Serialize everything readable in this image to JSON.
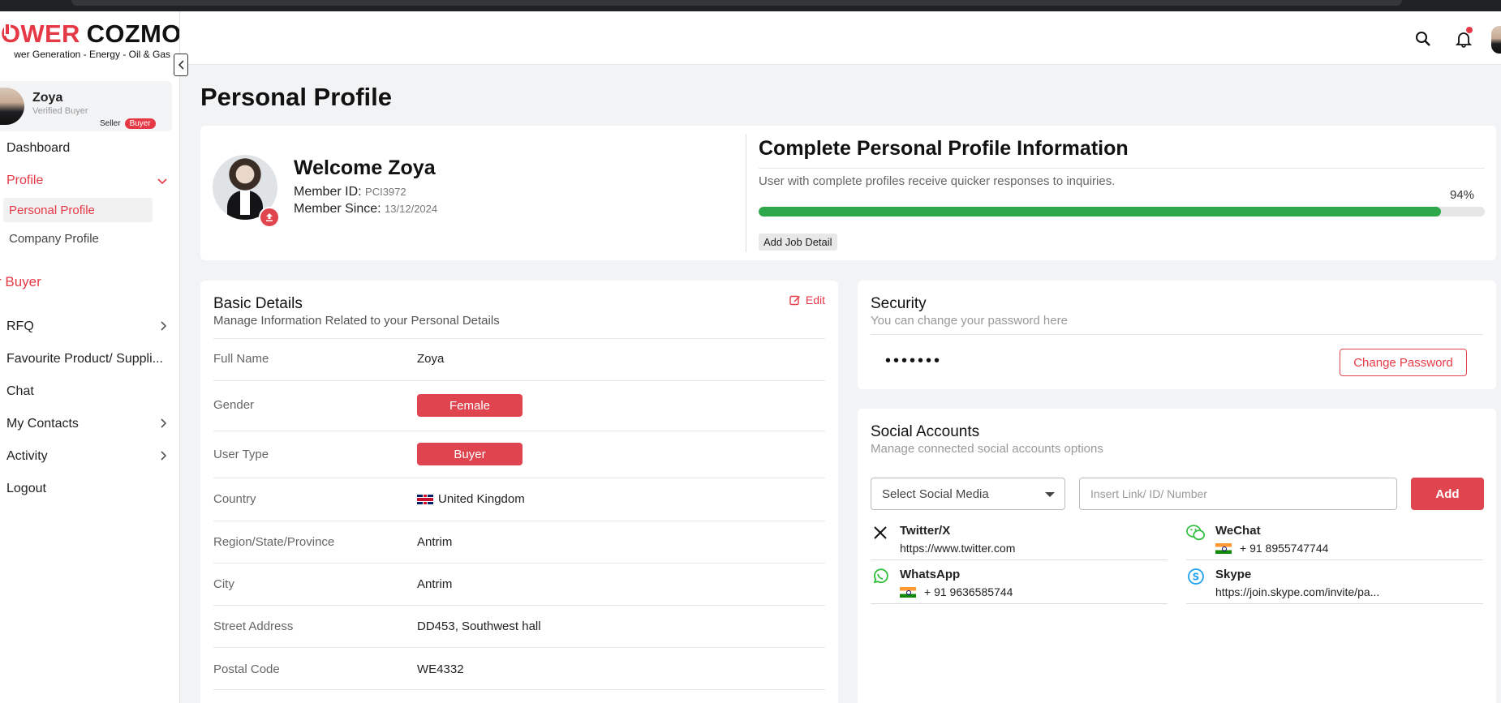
{
  "brand": {
    "logo_left": "OWER",
    "logo_right": "COZMO",
    "tagline": "wer Generation - Energy - Oil & Gas"
  },
  "user": {
    "name": "Zoya",
    "status": "Verified Buyer",
    "role_seller": "Seller",
    "role_buyer": "Buyer"
  },
  "sidebar": {
    "dashboard": "Dashboard",
    "profile": "Profile",
    "personal_profile": "Personal Profile",
    "company_profile": "Company Profile",
    "section": "r Buyer",
    "rfq": "RFQ",
    "favourite": "Favourite Product/ Suppli...",
    "chat": "Chat",
    "contacts": "My Contacts",
    "activity": "Activity",
    "logout": "Logout"
  },
  "page": {
    "title": "Personal Profile"
  },
  "welcome": {
    "title": "Welcome Zoya",
    "member_id_label": "Member ID:",
    "member_id": "PCI3972",
    "member_since_label": "Member Since:",
    "member_since": "13/12/2024"
  },
  "completion": {
    "title": "Complete Personal Profile Information",
    "description": "User with complete profiles receive quicker responses to inquiries.",
    "percent_label": "94%",
    "percent": 94,
    "badge": "Add Job Detail"
  },
  "basic": {
    "title": "Basic Details",
    "subtitle": "Manage Information Related to your Personal Details",
    "edit": "Edit",
    "rows": [
      {
        "label": "Full Name",
        "value": "Zoya"
      },
      {
        "label": "Gender",
        "value": "Female"
      },
      {
        "label": "User Type",
        "value": "Buyer"
      },
      {
        "label": "Country",
        "value": "United Kingdom"
      },
      {
        "label": "Region/State/Province",
        "value": "Antrim"
      },
      {
        "label": "City",
        "value": "Antrim"
      },
      {
        "label": "Street Address",
        "value": "DD453, Southwest hall"
      },
      {
        "label": "Postal Code",
        "value": "WE4332"
      }
    ]
  },
  "security": {
    "title": "Security",
    "subtitle": "You can change your password here",
    "password_mask": "•••••••",
    "change_button": "Change Password"
  },
  "social": {
    "title": "Social Accounts",
    "subtitle": "Manage connected social accounts options",
    "select_placeholder": "Select Social Media",
    "input_placeholder": "Insert Link/ ID/ Number",
    "add_button": "Add",
    "items": [
      {
        "name": "Twitter/X",
        "value": "https://www.twitter.com"
      },
      {
        "name": "WeChat",
        "value": "+ 91 8955747744"
      },
      {
        "name": "WhatsApp",
        "value": "+ 91 9636585744"
      },
      {
        "name": "Skype",
        "value": "https://join.skype.com/invite/pa..."
      }
    ]
  },
  "colors": {
    "accent": "#e63946",
    "progress": "#2ea84a"
  }
}
